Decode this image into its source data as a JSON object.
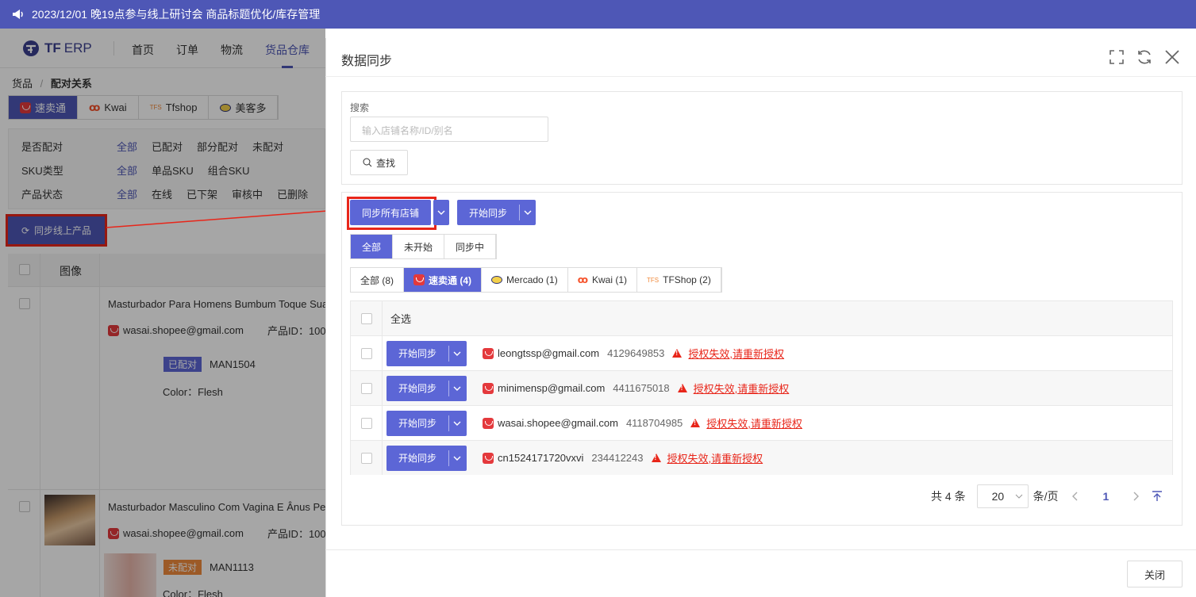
{
  "banner": {
    "text": "2023/12/01 晚19点参与线上研讨会 商品标题优化/库存管理"
  },
  "nav": {
    "logo_tf": "TF",
    "logo_erp": "ERP",
    "items": [
      "首页",
      "订单",
      "物流",
      "货品仓库"
    ]
  },
  "breadcrumb": {
    "root": "货品",
    "sep": "/",
    "current": "配对关系"
  },
  "platform_tabs": [
    "速卖通",
    "Kwai",
    "Tfshop",
    "美客多"
  ],
  "filters": {
    "pair": {
      "label": "是否配对",
      "options": [
        "全部",
        "已配对",
        "部分配对",
        "未配对"
      ]
    },
    "sku": {
      "label": "SKU类型",
      "options": [
        "全部",
        "单品SKU",
        "组合SKU"
      ]
    },
    "status": {
      "label": "产品状态",
      "options": [
        "全部",
        "在线",
        "已下架",
        "审核中",
        "已删除"
      ]
    }
  },
  "sync_online_button": "同步线上产品",
  "table": {
    "image_header": "图像",
    "products": [
      {
        "title": "Masturbador Para Homens Bumbum Toque Sua",
        "account": "wasai.shopee@gmail.com",
        "pid_label": "产品ID：100",
        "tag": "已配对",
        "sku": "MAN1504",
        "color": "Color：Flesh"
      },
      {
        "title": "Masturbador Masculino Com Vagina E Ânus Pe",
        "account": "wasai.shopee@gmail.com",
        "pid_label": "产品ID：100",
        "tag": "未配对",
        "sku": "MAN1113",
        "color": "Color：Flesh"
      }
    ]
  },
  "modal": {
    "title": "数据同步",
    "search_label": "搜索",
    "search_placeholder": "输入店铺名称/ID/别名",
    "find_button": "查找",
    "sync_all_button": "同步所有店铺",
    "start_sync_button": "开始同步",
    "status_tabs": [
      "全部",
      "未开始",
      "同步中"
    ],
    "platform_tabs": [
      "全部 (8)",
      "速卖通 (4)",
      "Mercado (1)",
      "Kwai (1)",
      "TFShop (2)"
    ],
    "select_all": "全选",
    "rows": [
      {
        "button": "开始同步",
        "email": "leongtssp@gmail.com",
        "id": "4129649853",
        "warn1": "授权失效",
        "warn2": ",请重新授权"
      },
      {
        "button": "开始同步",
        "email": "minimensp@gmail.com",
        "id": "4411675018",
        "warn1": "授权失效",
        "warn2": ",请重新授权"
      },
      {
        "button": "开始同步",
        "email": "wasai.shopee@gmail.com",
        "id": "4118704985",
        "warn1": "授权失效",
        "warn2": ",请重新授权"
      },
      {
        "button": "开始同步",
        "email": "cn1524171720vxvi",
        "id": "234412243",
        "warn1": "授权失效",
        "warn2": ",请重新授权"
      }
    ],
    "pager": {
      "total": "共 4 条",
      "page_size": "20",
      "per_page": "条/页",
      "page": "1"
    },
    "close_button": "关闭"
  },
  "colors": {
    "primary": "#4e57b6",
    "button": "#5c66d6",
    "warning": "#e8261a",
    "highlight_box": "#e8261a"
  }
}
